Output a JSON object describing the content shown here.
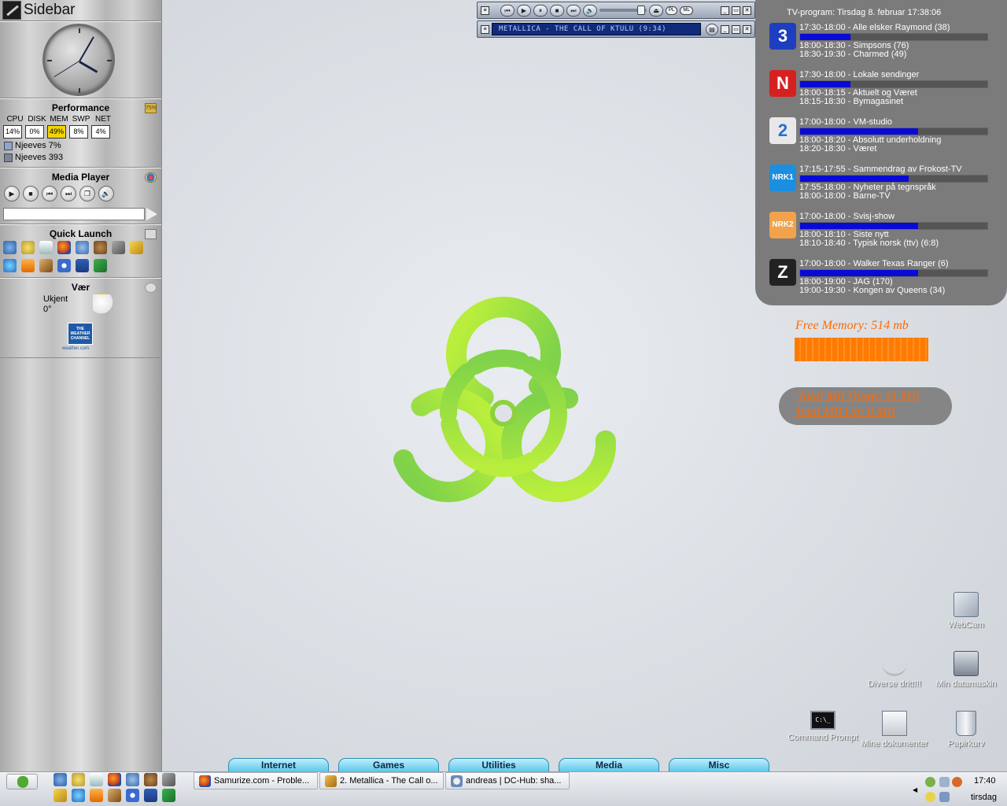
{
  "sidebar": {
    "title": "Sidebar",
    "performance": {
      "heading": "Performance",
      "icon_text": "75%",
      "labels": [
        "CPU",
        "DISK",
        "MEM",
        "SWP",
        "NET"
      ],
      "values": [
        "14%",
        "0%",
        "49%",
        "8%",
        "4%"
      ],
      "lines": [
        "Njeeves 7%",
        "Njeeves 393"
      ]
    },
    "media_player": {
      "heading": "Media Player",
      "buttons": [
        "play",
        "stop",
        "previous",
        "next",
        "window",
        "volume"
      ]
    },
    "quick_launch": {
      "heading": "Quick Launch",
      "icons": [
        "globe-icon",
        "speaker-icon",
        "lt-icon",
        "firefox-icon",
        "thunderbird-icon",
        "bear-icon",
        "tools-icon",
        "keys-icon",
        "ie-icon",
        "vlc-icon",
        "pencil-icon",
        "winamp-icon",
        "word-icon",
        "xchat-icon"
      ]
    },
    "weather": {
      "heading": "Vær",
      "location": "Ukjent",
      "temperature": "0°",
      "logo_text": "THE WEATHER CHANNEL",
      "logo_url": "weather.com"
    }
  },
  "winamp": {
    "track_display": "METALLICA - THE CALL OF KTULU (9:34)",
    "pill_buttons": [
      "PL",
      "ML"
    ]
  },
  "tv": {
    "header": "TV-program: Tirsdag 8. februar 17:38:06",
    "entries": [
      {
        "channel": "TV3",
        "logo": "3",
        "color": "#1d3fbf",
        "now": "17:30-18:00 - Alle elsker Raymond (38)",
        "progress": 0.27,
        "next1": "18:00-18:30 - Simpsons (76)",
        "next2": "18:30-19:30 - Charmed (49)"
      },
      {
        "channel": "TVNorge",
        "logo": "N",
        "color": "#d62020",
        "now": "17:30-18:00 - Lokale sendinger",
        "progress": 0.27,
        "next1": "18:00-18:15 - Aktuelt og Været",
        "next2": "18:15-18:30 - Bymagasinet"
      },
      {
        "channel": "TV2",
        "logo": "2",
        "color": "#e8e8e8",
        "now": "17:00-18:00 - VM-studio",
        "progress": 0.63,
        "next1": "18:00-18:20 - Absolutt underholdning",
        "next2": "18:20-18:30 - Været"
      },
      {
        "channel": "NRK1",
        "logo": "NRK1",
        "color": "#1a8fe0",
        "now": "17:15-17:55 - Sammendrag av Frokost-TV",
        "progress": 0.58,
        "next1": "17:55-18:00 - Nyheter på tegnspråk",
        "next2": "18:00-18:00 - Barne-TV"
      },
      {
        "channel": "NRK2",
        "logo": "NRK2",
        "color": "#f2a24a",
        "now": "17:00-18:00 - Svisj-show",
        "progress": 0.63,
        "next1": "18:00-18:10 - Siste nytt",
        "next2": "18:10-18:40 - Typisk norsk (ttv) (6:8)"
      },
      {
        "channel": "ZTV",
        "logo": "Z",
        "color": "#222222",
        "now": "17:00-18:00 - Walker Texas Ranger (6)",
        "progress": 0.63,
        "next1": "18:00-19:00 - JAG (170)",
        "next2": "19:00-19:30 - Kongen av Queens (34)"
      }
    ]
  },
  "memory": {
    "free_label": "Free Memory: 514 mb",
    "bar_fill": 1.0
  },
  "network": {
    "down_label": "Total MB Down: 41 MB",
    "up_label": "Total MB Up: 0 MB"
  },
  "desktop_icons": [
    {
      "label": "WebCam",
      "icon": "folder-icon"
    },
    {
      "label": "Diverse dritt!!!",
      "icon": "shortcut-icon"
    },
    {
      "label": "Min datamaskin",
      "icon": "computer-icon"
    },
    {
      "label": "Command Prompt",
      "icon": "terminal-icon"
    },
    {
      "label": "Mine dokumenter",
      "icon": "documents-icon"
    },
    {
      "label": "Papirkurv",
      "icon": "recycle-bin-icon"
    }
  ],
  "category_tabs": [
    "Internet",
    "Games",
    "Utilities",
    "Media",
    "Misc"
  ],
  "taskbar": {
    "tasks": [
      {
        "label": "Samurize.com - Proble...",
        "icon": "firefox-icon"
      },
      {
        "label": "2. Metallica - The Call o...",
        "icon": "winamp-icon"
      },
      {
        "label": "andreas | DC-Hub: sha...",
        "icon": "dc-hub-icon"
      }
    ],
    "time": "17:40",
    "day": "tirsdag"
  }
}
